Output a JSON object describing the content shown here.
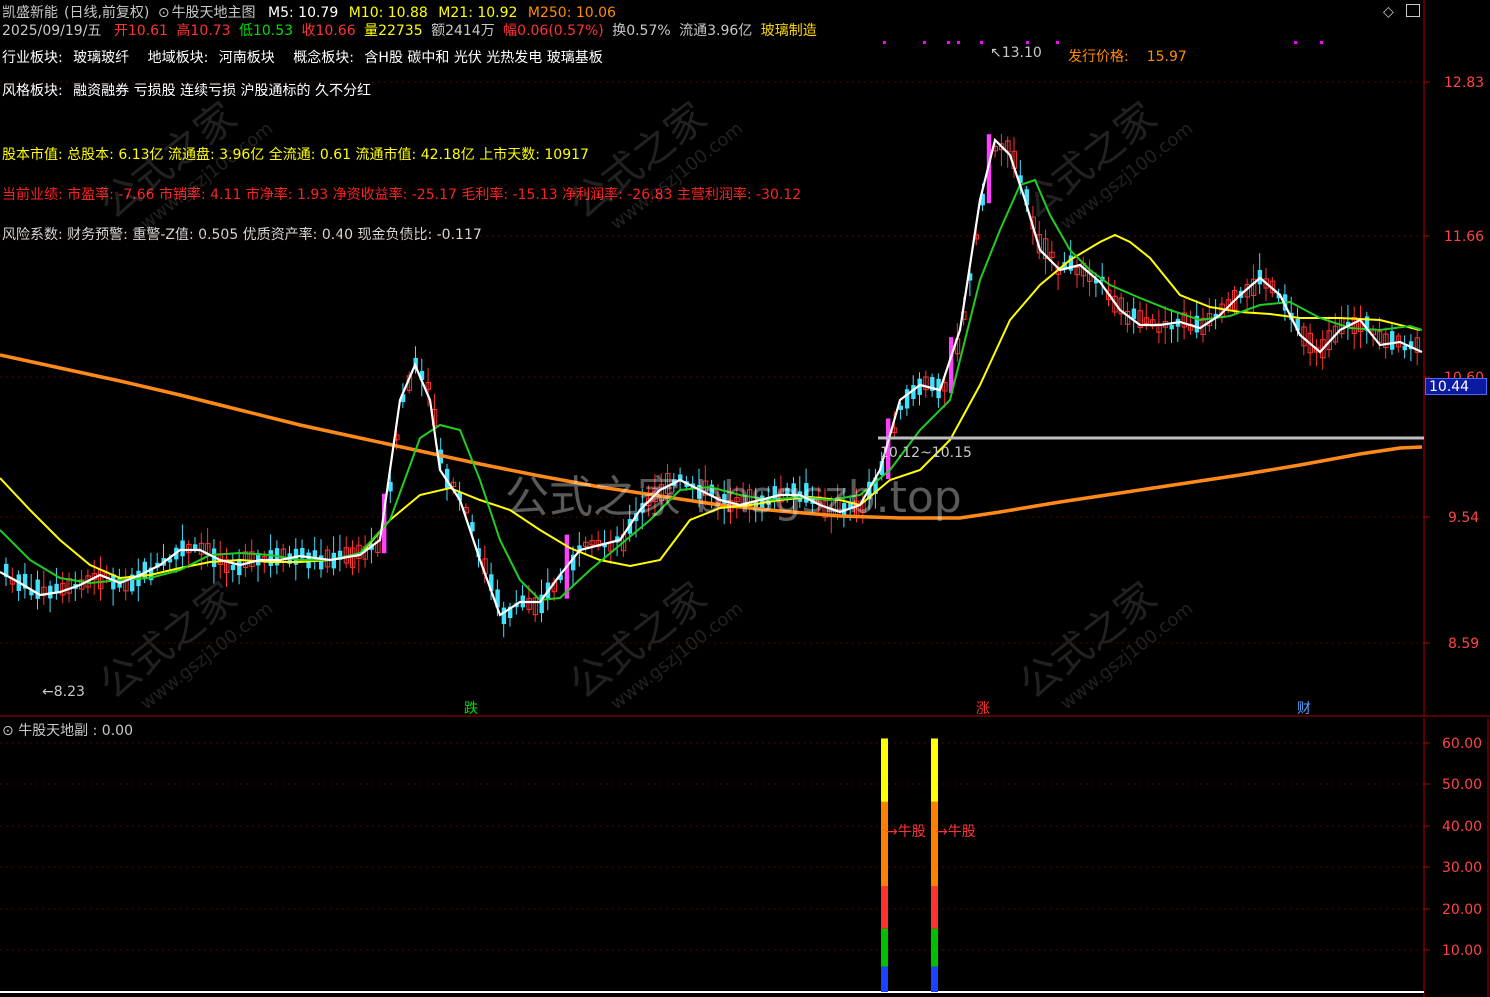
{
  "header": {
    "stock_name": "凯盛新能",
    "period": "(日线,前复权)",
    "indicator_name": "牛股天地主图",
    "ma": [
      {
        "label": "M5: 10.79",
        "color": "#ffffff"
      },
      {
        "label": "M10: 10.88",
        "color": "#ffff00"
      },
      {
        "label": "M21: 10.92",
        "color": "#ffff00"
      },
      {
        "label": "M250: 10.06",
        "color": "#ff8c00"
      }
    ],
    "date": "2025/09/19/五",
    "quote": [
      {
        "label": "开",
        "value": "10.61",
        "color": "#ff3333"
      },
      {
        "label": "高",
        "value": "10.73",
        "color": "#ff3333"
      },
      {
        "label": "低",
        "value": "10.53",
        "color": "#00e000"
      },
      {
        "label": "收",
        "value": "10.66",
        "color": "#ff3333"
      },
      {
        "label": "量",
        "value": "22735",
        "color": "#ffff00"
      },
      {
        "label": "额",
        "value": "2414万",
        "color": "#c8c8c8"
      },
      {
        "label": "幅",
        "value": "0.06(0.57%)",
        "color": "#ff3333"
      },
      {
        "label": "换",
        "value": "0.57%",
        "color": "#c8c8c8"
      },
      {
        "label": "流通",
        "value": "3.96亿",
        "color": "#c8c8c8"
      }
    ],
    "industry_tag": "玻璃制造",
    "top_icons": [
      "diamond-icon",
      "window-icon"
    ]
  },
  "info": {
    "industry_label": "行业板块:",
    "industry_value": "玻璃玻纤",
    "region_label": "地域板块:",
    "region_value": "河南板块",
    "concept_label": "概念板块:",
    "concept_value": "含H股 碳中和 光伏 光热发电 玻璃基板",
    "issue_label": "发行价格:",
    "issue_value": "15.97",
    "style_label": "风格板块:",
    "style_value": "融资融券 亏损股 连续亏损 沪股通标的 久不分红",
    "capital_line": "股本市值: 总股本: 6.13亿 流通盘: 3.96亿 全流通: 0.61 流通市值: 42.18亿 上市天数: 10917",
    "perf_line": "当前业绩: 市盈率: -7.66 市销率: 4.11 市净率: 1.93 净资收益率: -25.17 毛利率: -15.13 净利润率: -26.83 主营利润率: -30.12",
    "risk_line": "风险系数: 财务预警: 重警-Z值: 0.505 优质资产率: 0.40 现金负债比: -0.117"
  },
  "main_chart": {
    "y_ticks": [
      "12.83",
      "11.66",
      "10.60",
      "9.54",
      "8.59"
    ],
    "current_price": "10.44",
    "high_mark": "13.10",
    "low_mark": "8.23",
    "range_label": "10.12~10.15",
    "markers": [
      {
        "text": "跌",
        "color": "#00e000"
      },
      {
        "text": "涨",
        "color": "#ff3333"
      },
      {
        "text": "财",
        "color": "#4da3ff"
      }
    ],
    "watermark_center": "公式之家 bhsgszb.top",
    "watermark_tile": "公式之家",
    "watermark_url": "www.gszj100.com"
  },
  "sub_chart": {
    "title": "牛股天地副",
    "value": ": 0.00",
    "y_ticks": [
      "60.00",
      "50.00",
      "40.00",
      "30.00",
      "20.00",
      "10.00"
    ],
    "signal_label": "牛股",
    "signal_label_2": "牛股"
  },
  "chart_data": {
    "type": "candlestick",
    "ylim": [
      8.1,
      13.4
    ],
    "sub_ylim": [
      0,
      62
    ],
    "sub_bars": [
      {
        "segments": [
          {
            "to": 6,
            "color": "#1e40ff"
          },
          {
            "to": 15,
            "color": "#00c000"
          },
          {
            "to": 25,
            "color": "#ff3030"
          },
          {
            "to": 45,
            "color": "#ff7f00"
          },
          {
            "to": 60,
            "color": "#ffff00"
          }
        ]
      },
      {
        "segments": [
          {
            "to": 6,
            "color": "#1e40ff"
          },
          {
            "to": 15,
            "color": "#00c000"
          },
          {
            "to": 25,
            "color": "#ff3030"
          },
          {
            "to": 45,
            "color": "#ff7f00"
          },
          {
            "to": 60,
            "color": "#ffff00"
          }
        ]
      }
    ]
  }
}
